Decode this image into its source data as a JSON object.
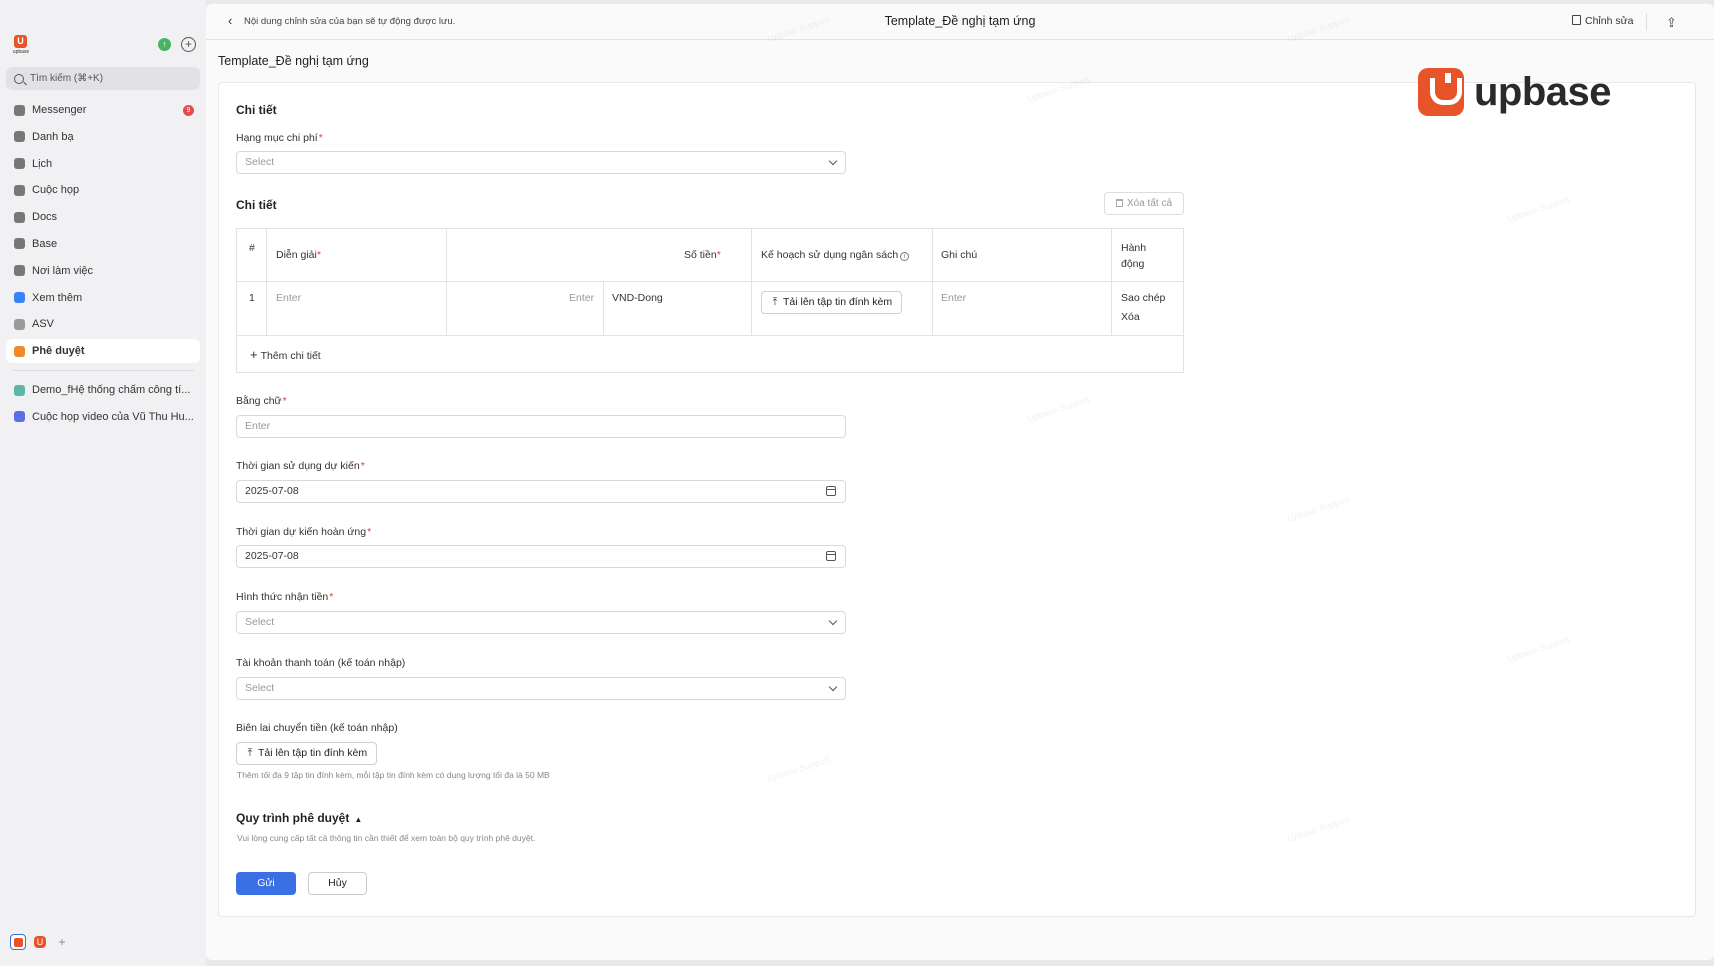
{
  "sidebar": {
    "search_placeholder": "Tìm kiếm (⌘+K)",
    "logo_text": "upbase",
    "items": [
      {
        "label": "Messenger",
        "badge": "9"
      },
      {
        "label": "Danh bạ"
      },
      {
        "label": "Lịch"
      },
      {
        "label": "Cuộc họp"
      },
      {
        "label": "Docs"
      },
      {
        "label": "Base"
      },
      {
        "label": "Nơi làm việc"
      },
      {
        "label": "Xem thêm"
      },
      {
        "label": "ASV"
      },
      {
        "label": "Phê duyệt",
        "active": true
      }
    ],
    "recent": [
      {
        "label": "Demo_fHệ thống chấm công tí..."
      },
      {
        "label": "Cuộc họp video của Vũ Thu Hu..."
      }
    ],
    "accent": "#e8542a"
  },
  "topbar": {
    "autosave": "Nội dung chỉnh sửa của bạn sẽ tự động được lưu.",
    "title": "Template_Đề nghị tạm ứng",
    "edit": "Chỉnh sửa"
  },
  "page": {
    "title": "Template_Đề nghị tạm ứng",
    "brand": "upbase",
    "watermark": "Upbase Support"
  },
  "form": {
    "section_detail": "Chi tiết",
    "category_label": "Hạng mục chi phí",
    "category_value": "Select",
    "detail_title": "Chi tiết",
    "clear_all": "Xóa tất cả",
    "table": {
      "headers": {
        "index": "#",
        "desc": "Diễn giải",
        "amount": "Số tiền",
        "budget": "Kế hoạch sử dụng ngân sách",
        "note": "Ghi chú",
        "action": "Hành động"
      },
      "rows": [
        {
          "index": "1",
          "desc": "Enter",
          "amount": "Enter",
          "currency": "VND-Dong",
          "upload": "Tải lên tập tin đính kèm",
          "note": "Enter",
          "copy": "Sao chép",
          "delete": "Xóa"
        }
      ],
      "add_row": "Thêm chi tiết"
    },
    "words_label": "Bằng chữ",
    "words_value": "Enter",
    "use_time_label": "Thời gian sử dụng dự kiến",
    "use_time_value": "2025-07-08",
    "refund_time_label": "Thời gian dự kiến hoàn ứng",
    "refund_time_value": "2025-07-08",
    "receive_label": "Hình thức nhận tiền",
    "receive_value": "Select",
    "account_label": "Tài khoản thanh toán (kế toán nhập)",
    "account_value": "Select",
    "receipt_label": "Biên lai chuyển tiền (kế toán nhập)",
    "receipt_upload": "Tải lên tập tin đính kèm",
    "receipt_hint": "Thêm tối đa 9 tập tin đính kèm, mỗi tập tin đính kèm có dung lượng tối đa là 50 MB",
    "workflow_title": "Quy trình phê duyệt",
    "workflow_hint": "Vui lòng cung cấp tất cả thông tin cần thiết để xem toàn bộ quy trình phê duyệt.",
    "submit": "Gửi",
    "cancel": "Hủy"
  }
}
